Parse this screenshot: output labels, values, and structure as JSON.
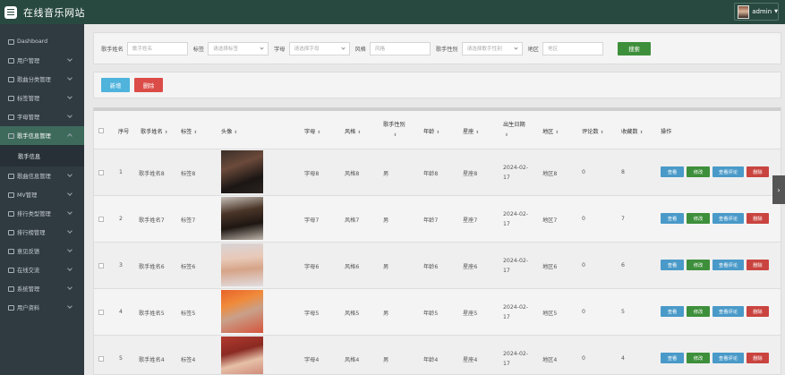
{
  "header": {
    "title": "在线音乐网站",
    "user": "admin"
  },
  "sidebar": {
    "items": [
      {
        "label": "Dashboard"
      },
      {
        "label": "用户管理"
      },
      {
        "label": "歌曲分类管理"
      },
      {
        "label": "标签管理"
      },
      {
        "label": "字母管理"
      },
      {
        "label": "歌手信息管理"
      },
      {
        "label": "歌曲信息管理"
      },
      {
        "label": "MV管理"
      },
      {
        "label": "排行类型管理"
      },
      {
        "label": "排行榜管理"
      },
      {
        "label": "意见反馈"
      },
      {
        "label": "在线交流"
      },
      {
        "label": "系统管理"
      },
      {
        "label": "用户资料"
      }
    ],
    "active_sub": "歌手信息"
  },
  "search": {
    "singer_label": "歌手姓名",
    "singer_placeholder": "歌手姓名",
    "tag_label": "标签",
    "tag_placeholder": "请选择标签",
    "letter_label": "字母",
    "letter_placeholder": "请选择字母",
    "style_label": "风格",
    "style_placeholder": "风格",
    "gender_label": "歌手性别",
    "gender_placeholder": "请选择歌手性别",
    "region_label": "地区",
    "region_placeholder": "地区",
    "search_button": "搜索"
  },
  "actions": {
    "add": "新增",
    "delete": "删除"
  },
  "table": {
    "headers": {
      "index": "序号",
      "name": "歌手姓名",
      "tag": "标签",
      "photo": "头像",
      "letter": "字母",
      "style": "风格",
      "gender": "歌手性别",
      "age": "年龄",
      "zodiac": "星座",
      "birthday": "出生日期",
      "region": "地区",
      "reviews": "评论数",
      "favorites": "收藏数",
      "ops": "操作"
    },
    "op_labels": {
      "view": "查看",
      "edit": "修改",
      "reviews": "查看评论",
      "delete": "删除"
    },
    "rows": [
      {
        "index": "1",
        "name": "歌手姓名8",
        "tag": "标签8",
        "letter": "字母8",
        "style": "风格8",
        "gender": "男",
        "age": "年龄8",
        "zodiac": "星座8",
        "birthday": "2024-02-17",
        "region": "地区8",
        "reviews": "0",
        "favorites": "8"
      },
      {
        "index": "2",
        "name": "歌手姓名7",
        "tag": "标签7",
        "letter": "字母7",
        "style": "风格7",
        "gender": "男",
        "age": "年龄7",
        "zodiac": "星座7",
        "birthday": "2024-02-17",
        "region": "地区7",
        "reviews": "0",
        "favorites": "7"
      },
      {
        "index": "3",
        "name": "歌手姓名6",
        "tag": "标签6",
        "letter": "字母6",
        "style": "风格6",
        "gender": "男",
        "age": "年龄6",
        "zodiac": "星座6",
        "birthday": "2024-02-17",
        "region": "地区6",
        "reviews": "0",
        "favorites": "6"
      },
      {
        "index": "4",
        "name": "歌手姓名5",
        "tag": "标签5",
        "letter": "字母5",
        "style": "风格5",
        "gender": "男",
        "age": "年龄5",
        "zodiac": "星座5",
        "birthday": "2024-02-17",
        "region": "地区5",
        "reviews": "0",
        "favorites": "5"
      },
      {
        "index": "5",
        "name": "歌手姓名4",
        "tag": "标签4",
        "letter": "字母4",
        "style": "风格4",
        "gender": "男",
        "age": "年龄4",
        "zodiac": "星座4",
        "birthday": "2024-02-17",
        "region": "地区4",
        "reviews": "0",
        "favorites": "4"
      }
    ]
  },
  "colors": {
    "header": "#28493f",
    "sidebar": "#2f3a41",
    "accent_green": "#3e8f3b",
    "accent_blue": "#4fb3dc",
    "danger": "#db4c48"
  }
}
